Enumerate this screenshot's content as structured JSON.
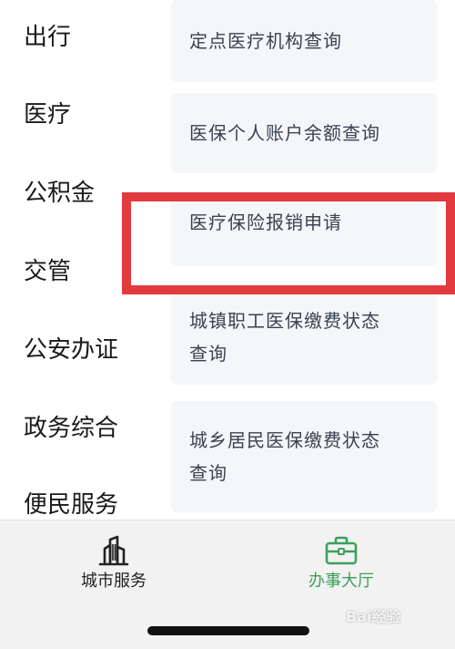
{
  "sidebar": {
    "items": [
      {
        "label": "出行"
      },
      {
        "label": "医疗"
      },
      {
        "label": "公积金"
      },
      {
        "label": "交管"
      },
      {
        "label": "公安办证"
      },
      {
        "label": "政务综合"
      },
      {
        "label": "便民服务"
      }
    ]
  },
  "services": [
    {
      "lines": [
        "定点医疗机构查询"
      ]
    },
    {
      "lines": [
        "医保个人账户余额查询"
      ]
    },
    {
      "lines": [
        "医疗保险报销申请"
      ],
      "highlighted": true
    },
    {
      "lines": [
        "城镇职工医保缴费状态",
        "查询"
      ]
    },
    {
      "lines": [
        "城乡居民医保缴费状态",
        "查询"
      ]
    }
  ],
  "tabbar": {
    "city_services": {
      "label": "城市服务",
      "icon": "city-buildings-icon"
    },
    "service_hall": {
      "label": "办事大厅",
      "icon": "briefcase-icon",
      "active": true
    }
  },
  "colors": {
    "active_tab": "#3da05c",
    "highlight_border": "#e23a3f",
    "card_background": "#f5f6f9"
  },
  "watermark": {
    "text": "Bai经验"
  }
}
